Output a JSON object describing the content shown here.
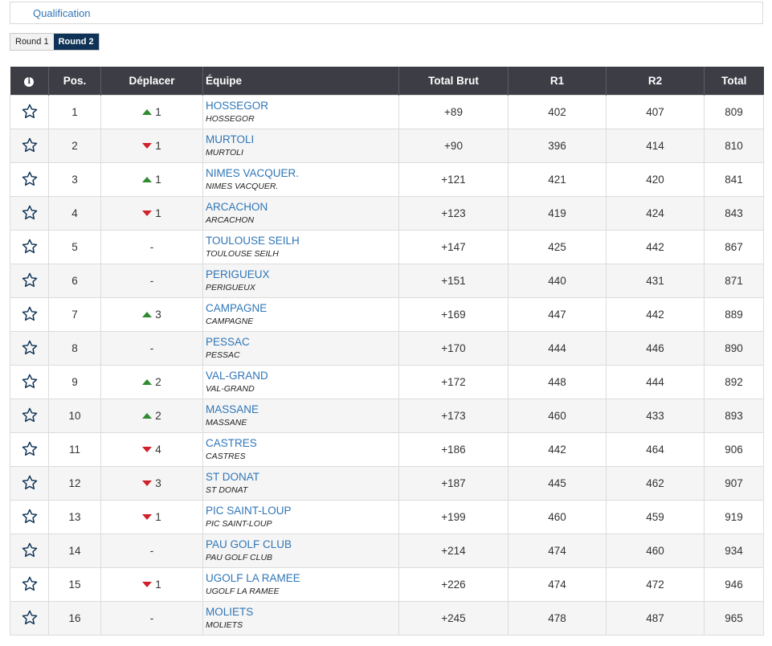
{
  "qualification_label": "Qualification",
  "rounds": [
    {
      "label": "Round 1",
      "active": false
    },
    {
      "label": "Round 2",
      "active": true
    }
  ],
  "table": {
    "headers": {
      "info": "i",
      "pos": "Pos.",
      "move": "Déplacer",
      "team": "Équipe",
      "total_brut": "Total Brut",
      "r1": "R1",
      "r2": "R2",
      "total": "Total"
    },
    "colors": {
      "up": "#2e8b2e",
      "down": "#d0202a",
      "link": "#2f76b7",
      "header_bg": "#3d3d46"
    },
    "rows": [
      {
        "pos": "1",
        "dir": "up",
        "move": "1",
        "team": "HOSSEGOR",
        "club": "HOSSEGOR",
        "brut": "+89",
        "r1": "402",
        "r2": "407",
        "total": "809"
      },
      {
        "pos": "2",
        "dir": "down",
        "move": "1",
        "team": "MURTOLI",
        "club": "MURTOLI",
        "brut": "+90",
        "r1": "396",
        "r2": "414",
        "total": "810"
      },
      {
        "pos": "3",
        "dir": "up",
        "move": "1",
        "team": "NIMES VACQUER.",
        "club": "NIMES VACQUER.",
        "brut": "+121",
        "r1": "421",
        "r2": "420",
        "total": "841"
      },
      {
        "pos": "4",
        "dir": "down",
        "move": "1",
        "team": "ARCACHON",
        "club": "ARCACHON",
        "brut": "+123",
        "r1": "419",
        "r2": "424",
        "total": "843"
      },
      {
        "pos": "5",
        "dir": "none",
        "move": "-",
        "team": "TOULOUSE SEILH",
        "club": "TOULOUSE SEILH",
        "brut": "+147",
        "r1": "425",
        "r2": "442",
        "total": "867"
      },
      {
        "pos": "6",
        "dir": "none",
        "move": "-",
        "team": "PERIGUEUX",
        "club": "PERIGUEUX",
        "brut": "+151",
        "r1": "440",
        "r2": "431",
        "total": "871"
      },
      {
        "pos": "7",
        "dir": "up",
        "move": "3",
        "team": "CAMPAGNE",
        "club": "CAMPAGNE",
        "brut": "+169",
        "r1": "447",
        "r2": "442",
        "total": "889"
      },
      {
        "pos": "8",
        "dir": "none",
        "move": "-",
        "team": "PESSAC",
        "club": "PESSAC",
        "brut": "+170",
        "r1": "444",
        "r2": "446",
        "total": "890"
      },
      {
        "pos": "9",
        "dir": "up",
        "move": "2",
        "team": "VAL-GRAND",
        "club": "VAL-GRAND",
        "brut": "+172",
        "r1": "448",
        "r2": "444",
        "total": "892"
      },
      {
        "pos": "10",
        "dir": "up",
        "move": "2",
        "team": "MASSANE",
        "club": "MASSANE",
        "brut": "+173",
        "r1": "460",
        "r2": "433",
        "total": "893"
      },
      {
        "pos": "11",
        "dir": "down",
        "move": "4",
        "team": "CASTRES",
        "club": "CASTRES",
        "brut": "+186",
        "r1": "442",
        "r2": "464",
        "total": "906"
      },
      {
        "pos": "12",
        "dir": "down",
        "move": "3",
        "team": "ST DONAT",
        "club": "ST DONAT",
        "brut": "+187",
        "r1": "445",
        "r2": "462",
        "total": "907"
      },
      {
        "pos": "13",
        "dir": "down",
        "move": "1",
        "team": "PIC SAINT-LOUP",
        "club": "PIC SAINT-LOUP",
        "brut": "+199",
        "r1": "460",
        "r2": "459",
        "total": "919"
      },
      {
        "pos": "14",
        "dir": "none",
        "move": "-",
        "team": "PAU GOLF CLUB",
        "club": "PAU GOLF CLUB",
        "brut": "+214",
        "r1": "474",
        "r2": "460",
        "total": "934"
      },
      {
        "pos": "15",
        "dir": "down",
        "move": "1",
        "team": "UGOLF LA RAMEE",
        "club": "UGOLF LA RAMEE",
        "brut": "+226",
        "r1": "474",
        "r2": "472",
        "total": "946"
      },
      {
        "pos": "16",
        "dir": "none",
        "move": "-",
        "team": "MOLIETS",
        "club": "MOLIETS",
        "brut": "+245",
        "r1": "478",
        "r2": "487",
        "total": "965"
      }
    ]
  }
}
